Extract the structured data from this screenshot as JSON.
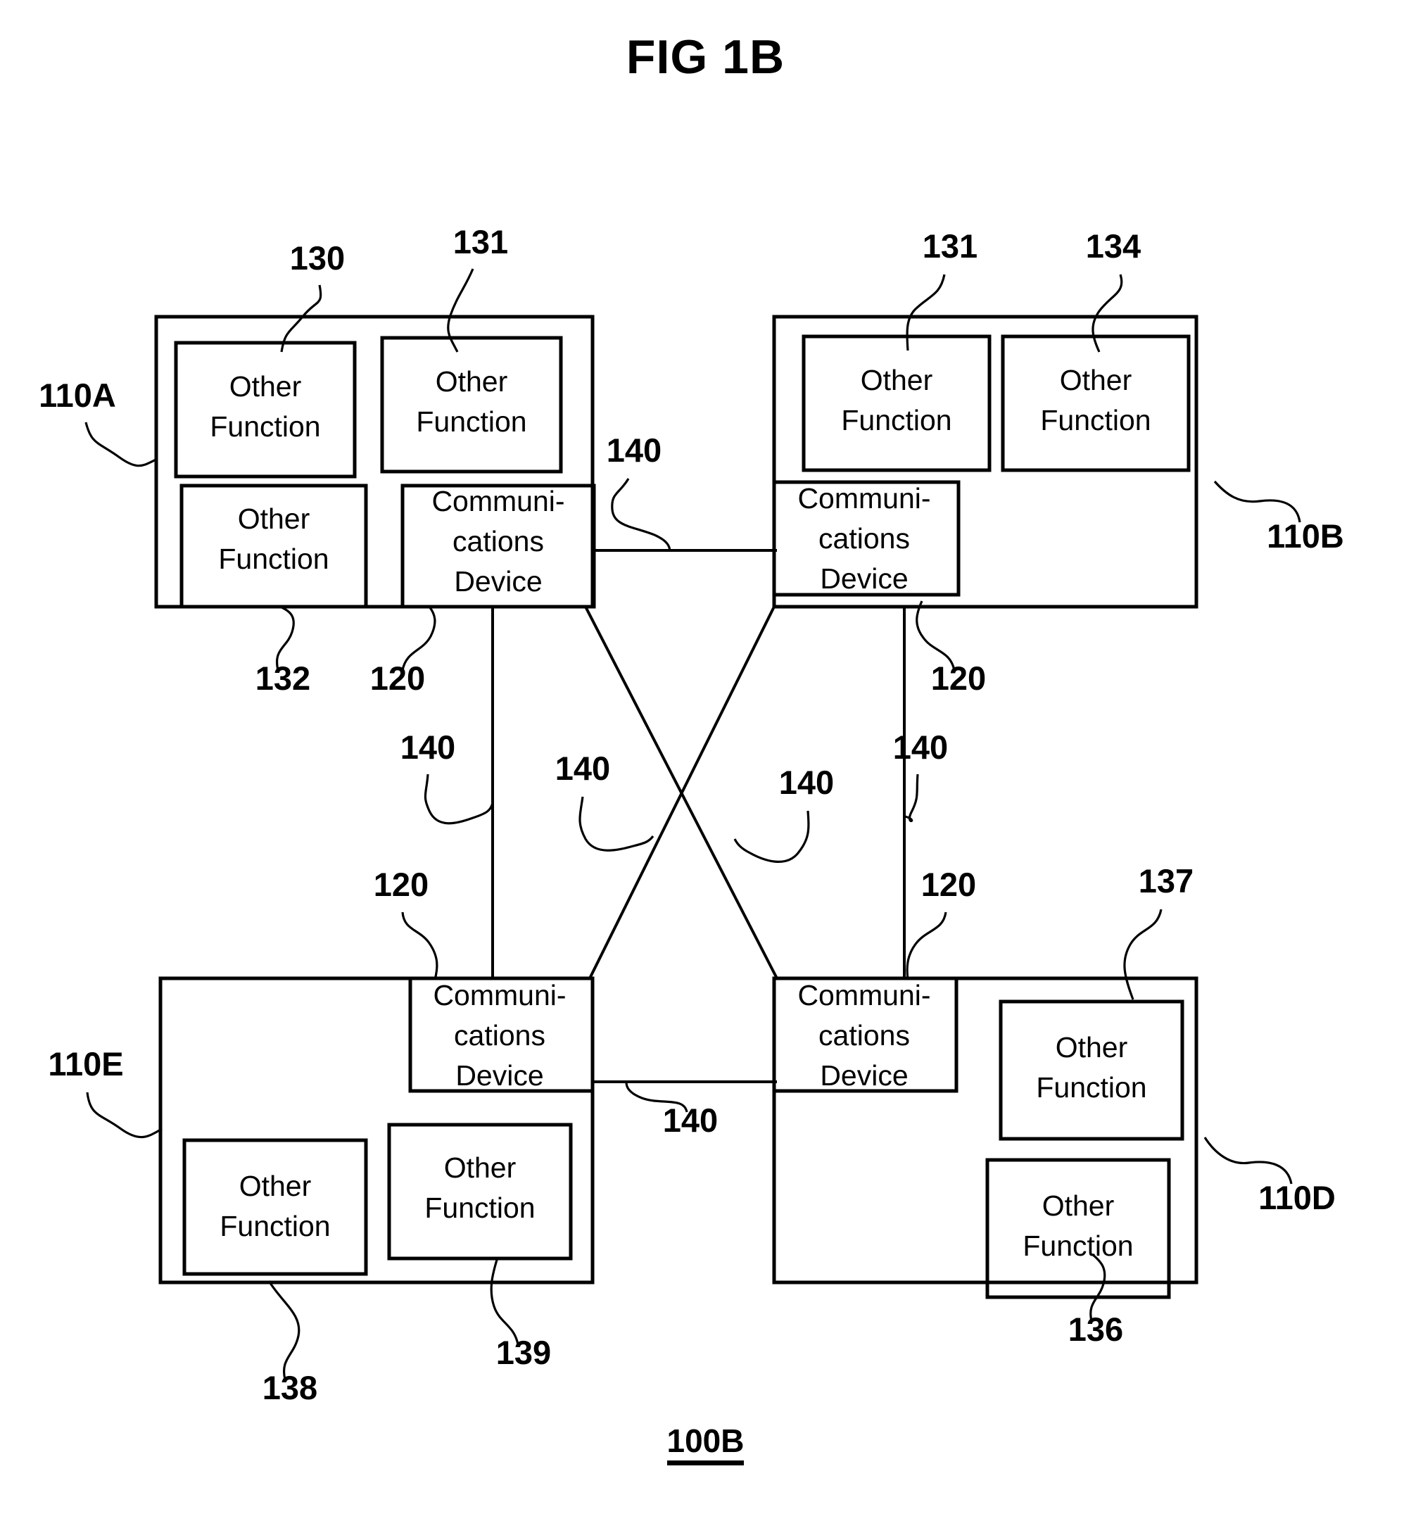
{
  "figure": {
    "title": "FIG 1B",
    "number": "100B"
  },
  "labels": {
    "other_function": [
      "Other",
      "Function"
    ],
    "communications_device": [
      "Communi-",
      "cations",
      "Device"
    ]
  },
  "nodes": [
    {
      "id": "110A",
      "ref": "110A",
      "position": "top-left",
      "children": [
        {
          "type": "other-function",
          "ref": "130",
          "text": [
            "Other",
            "Function"
          ]
        },
        {
          "type": "other-function",
          "ref": "131",
          "text": [
            "Other",
            "Function"
          ]
        },
        {
          "type": "other-function",
          "ref": "132",
          "text": [
            "Other",
            "Function"
          ]
        },
        {
          "type": "communications-device",
          "ref": "120",
          "text": [
            "Communi-",
            "cations",
            "Device"
          ]
        }
      ]
    },
    {
      "id": "110B",
      "ref": "110B",
      "position": "top-right",
      "children": [
        {
          "type": "other-function",
          "ref": "131",
          "text": [
            "Other",
            "Function"
          ]
        },
        {
          "type": "other-function",
          "ref": "134",
          "text": [
            "Other",
            "Function"
          ]
        },
        {
          "type": "communications-device",
          "ref": "120",
          "text": [
            "Communi-",
            "cations",
            "Device"
          ]
        }
      ]
    },
    {
      "id": "110E",
      "ref": "110E",
      "position": "bottom-left",
      "children": [
        {
          "type": "communications-device",
          "ref": "120",
          "text": [
            "Communi-",
            "cations",
            "Device"
          ]
        },
        {
          "type": "other-function",
          "ref": "138",
          "text": [
            "Other",
            "Function"
          ]
        },
        {
          "type": "other-function",
          "ref": "139",
          "text": [
            "Other",
            "Function"
          ]
        }
      ]
    },
    {
      "id": "110D",
      "ref": "110D",
      "position": "bottom-right",
      "children": [
        {
          "type": "communications-device",
          "ref": "120",
          "text": [
            "Communi-",
            "cations",
            "Device"
          ]
        },
        {
          "type": "other-function",
          "ref": "137",
          "text": [
            "Other",
            "Function"
          ]
        },
        {
          "type": "other-function",
          "ref": "136",
          "text": [
            "Other",
            "Function"
          ]
        }
      ]
    }
  ],
  "links": [
    {
      "ref": "140",
      "from": "110A",
      "to": "110B",
      "kind": "horizontal-top"
    },
    {
      "ref": "140",
      "from": "110A",
      "to": "110E",
      "kind": "vertical-left"
    },
    {
      "ref": "140",
      "from": "110B",
      "to": "110D",
      "kind": "vertical-right"
    },
    {
      "ref": "140",
      "from": "110A",
      "to": "110D",
      "kind": "diagonal"
    },
    {
      "ref": "140",
      "from": "110B",
      "to": "110E",
      "kind": "diagonal"
    },
    {
      "ref": "140",
      "from": "110E",
      "to": "110D",
      "kind": "horizontal-bottom"
    }
  ],
  "ref_numbers": {
    "n130": "130",
    "n131_left": "131",
    "n131_right": "131",
    "n134": "134",
    "n132": "132",
    "n136": "136",
    "n137": "137",
    "n138": "138",
    "n139": "139",
    "n110A": "110A",
    "n110B": "110B",
    "n110D": "110D",
    "n110E": "110E",
    "n120_tl": "120",
    "n120_tr": "120",
    "n120_bl": "120",
    "n120_br": "120",
    "n140_top": "140",
    "n140_left": "140",
    "n140_right": "140",
    "n140_diag_left": "140",
    "n140_diag_right": "140",
    "n140_bottom": "140"
  },
  "text_lines": {
    "other": "Other",
    "function": "Function",
    "communi": "Communi-",
    "cations": "cations",
    "device": "Device"
  }
}
